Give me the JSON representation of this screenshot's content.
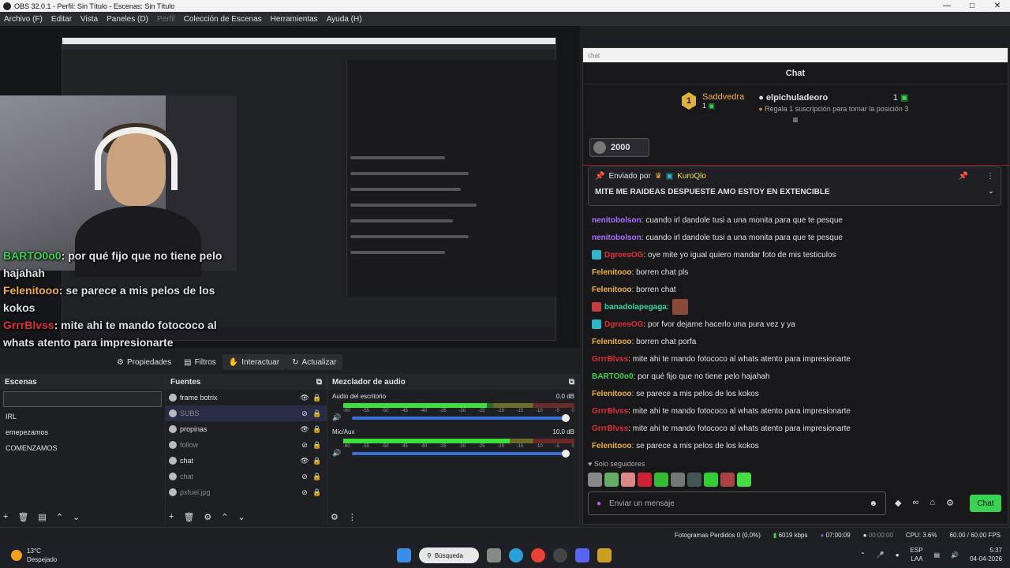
{
  "window": {
    "title": "OBS 32.0.1 - Perfil: Sin Título - Escenas: Sin Título"
  },
  "menu": [
    "Archivo (F)",
    "Editar",
    "Vista",
    "Paneles (D)",
    "Perfil",
    "Colección de Escenas",
    "Herramientas",
    "Ayuda (H)"
  ],
  "overlay_chat": [
    {
      "user": "BARTO0o0",
      "text": ": por qué fijo que no tiene pelo hajahah",
      "color": "#39d353"
    },
    {
      "user": "Felenitooo",
      "text": ": se parece a mis pelos de los kokos",
      "color": "#f0b040"
    },
    {
      "user": "GrrrBlvss",
      "text": ": mite ahi te mando fotococo al whats atento para impresionarte",
      "color": "#e0303a"
    },
    {
      "user": "GrrrBlvss",
      "text": ": mite ahi te mando fotococo al whats atento para impresionarte",
      "color": "#e0303a"
    },
    {
      "user": "Felenitooo",
      "text": ": se parece a mis pelos de los kokos",
      "color": "#f0b040"
    }
  ],
  "toolbar": {
    "props": "Propiedades",
    "filters": "Filtros",
    "interact": "Interactuar",
    "refresh": "Actualizar"
  },
  "scenes": {
    "title": "Escenas",
    "items": [
      "IRL",
      "emepezamos",
      "COMENZAMOS"
    ]
  },
  "sources": {
    "title": "Fuentes",
    "items": [
      "frame botrix",
      "SUBS",
      "propinas",
      "follow",
      "chat",
      "chat",
      "pxfuel.jpg"
    ]
  },
  "mixer": {
    "title": "Mezclador de audio",
    "channels": [
      {
        "name": "Audio del escritorio",
        "db": "0.0 dB",
        "level": 0.62
      },
      {
        "name": "Mic/Aux",
        "db": "10.0 dB",
        "level": 0.72
      }
    ],
    "ticks": [
      "-60",
      "-55",
      "-50",
      "-45",
      "-40",
      "-35",
      "-30",
      "-25",
      "-20",
      "-15",
      "-10",
      "-5",
      "0"
    ]
  },
  "chat": {
    "url": "chat",
    "header": "Chat",
    "leader": {
      "rank": "1",
      "name": "Saddvedra",
      "count": "1",
      "second_name": "elpichuladeoro",
      "second_count": "1",
      "second_hint": "Regala 1 suscripción para tomar la posición 3"
    },
    "hype_value": "2000",
    "pinned": {
      "by_label": "Enviado por",
      "by_user": "KuroQlo",
      "message": "MITE ME RAIDEAS DESPUESTE AMO ESTOY EN EXTENCIBLE"
    },
    "messages": [
      {
        "user": "nenitobolson",
        "text": ": cuando irl dandole tusi a una monita para que te pesque",
        "color": "#a970ff",
        "icon": ""
      },
      {
        "user": "nenitobolson",
        "text": ": cuando irl dandole tusi a una monita para que te pesque",
        "color": "#a970ff",
        "icon": ""
      },
      {
        "user": "DgreesOG",
        "text": ": oye mite yo igual quiero mandar foto de mis testiculos",
        "color": "#e0303a",
        "icon": "#2fb7c9"
      },
      {
        "user": "Felenitooo",
        "text": ": borren chat pls",
        "color": "#f0b040",
        "icon": ""
      },
      {
        "user": "Felenitooo",
        "text": ": borren chat",
        "color": "#f0b040",
        "icon": ""
      },
      {
        "user": "banadolapegaga",
        "text": ":",
        "color": "#39d3a0",
        "icon": "#c04040"
      },
      {
        "user": "DgreesOG",
        "text": ": por fvor dejame hacerlo una pura vez y ya",
        "color": "#e0303a",
        "icon": "#2fb7c9"
      },
      {
        "user": "Felenitooo",
        "text": ": borren chat porfa",
        "color": "#f0b040",
        "icon": ""
      },
      {
        "user": "GrrrBlvss",
        "text": ": mite ahi te mando fotococo al whats atento para impresionarte",
        "color": "#e0303a",
        "icon": ""
      },
      {
        "user": "BARTO0o0",
        "text": ": por qué fijo que no tiene pelo hajahah",
        "color": "#39d353",
        "icon": ""
      },
      {
        "user": "Felenitooo",
        "text": ": se parece a mis pelos de los kokos",
        "color": "#f0b040",
        "icon": ""
      },
      {
        "user": "GrrrBlvss",
        "text": ": mite ahi te mando fotococo al whats atento para impresionarte",
        "color": "#e0303a",
        "icon": ""
      },
      {
        "user": "GrrrBlvss",
        "text": ": mite ahi te mando fotococo al whats atento para impresionarte",
        "color": "#e0303a",
        "icon": ""
      },
      {
        "user": "Felenitooo",
        "text": ": se parece a mis pelos de los kokos",
        "color": "#f0b040",
        "icon": ""
      }
    ],
    "followers_label": "Solo seguidores",
    "input_placeholder": "Enviar un mensaje",
    "send_label": "Chat"
  },
  "status": {
    "dropped": "Fotogramas Perdidos 0 (0.0%)",
    "bitrate": "6019 kbps",
    "stream_time": "07:00:09",
    "rec_time": "00:00:00",
    "cpu": "CPU: 3.6%",
    "fps": "60.00 / 60.00 FPS"
  },
  "taskbar": {
    "temp": "13°C",
    "weather": "Despejado",
    "search": "Búsqueda",
    "lang1": "ESP",
    "lang2": "LAA",
    "time": "5:37",
    "date": "04-04-2026"
  }
}
